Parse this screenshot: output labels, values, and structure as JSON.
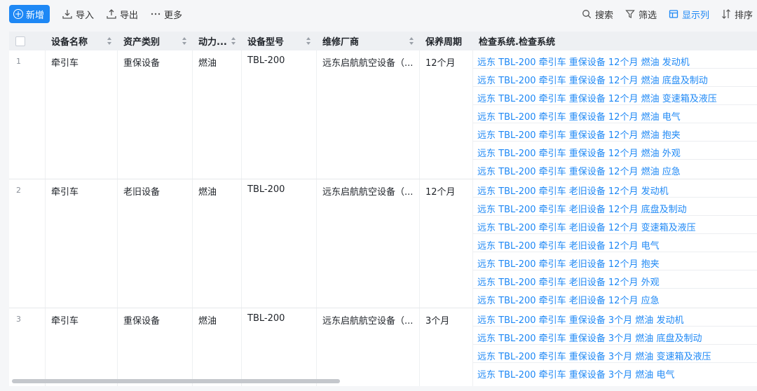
{
  "toolbar": {
    "new_label": "新增",
    "import_label": "导入",
    "export_label": "导出",
    "more_label": "更多",
    "search_label": "搜索",
    "filter_label": "筛选",
    "columns_label": "显示列",
    "sort_label": "排序"
  },
  "columns": {
    "name": "设备名称",
    "category": "资产类别",
    "power": "动力...",
    "model": "设备型号",
    "vendor": "维修厂商",
    "period": "保养周期",
    "inspect": "检查系统.检查系统"
  },
  "rows": [
    {
      "index": "1",
      "name": "牵引车",
      "category": "重保设备",
      "power": "燃油",
      "model": "TBL-200",
      "vendor": "远东启航航空设备（...",
      "period": "12个月",
      "inspect": [
        "远东 TBL-200 牵引车 重保设备 12个月 燃油 发动机",
        "远东 TBL-200 牵引车 重保设备 12个月 燃油 底盘及制动",
        "远东 TBL-200 牵引车 重保设备 12个月 燃油 变速箱及液压",
        "远东 TBL-200 牵引车 重保设备 12个月 燃油 电气",
        "远东 TBL-200 牵引车 重保设备 12个月 燃油 抱夹",
        "远东 TBL-200 牵引车 重保设备 12个月 燃油 外观",
        "远东 TBL-200 牵引车 重保设备 12个月 燃油 应急"
      ]
    },
    {
      "index": "2",
      "name": "牵引车",
      "category": "老旧设备",
      "power": "燃油",
      "model": "TBL-200",
      "vendor": "远东启航航空设备（...",
      "period": "12个月",
      "inspect": [
        "远东 TBL-200 牵引车 老旧设备 12个月 发动机",
        "远东 TBL-200 牵引车 老旧设备 12个月 底盘及制动",
        "远东 TBL-200 牵引车 老旧设备 12个月 变速箱及液压",
        "远东 TBL-200 牵引车 老旧设备 12个月 电气",
        "远东 TBL-200 牵引车 老旧设备 12个月 抱夹",
        "远东 TBL-200 牵引车 老旧设备 12个月 外观",
        "远东 TBL-200 牵引车 老旧设备 12个月 应急"
      ]
    },
    {
      "index": "3",
      "name": "牵引车",
      "category": "重保设备",
      "power": "燃油",
      "model": "TBL-200",
      "vendor": "远东启航航空设备（...",
      "period": "3个月",
      "inspect": [
        "远东 TBL-200 牵引车 重保设备 3个月 燃油 发动机",
        "远东 TBL-200 牵引车 重保设备 3个月 燃油 底盘及制动",
        "远东 TBL-200 牵引车 重保设备 3个月 燃油 变速箱及液压",
        "远东 TBL-200 牵引车 重保设备 3个月 燃油 电气"
      ]
    }
  ],
  "colors": {
    "accent": "#1e88f5",
    "header_bg": "#eef0f3"
  }
}
